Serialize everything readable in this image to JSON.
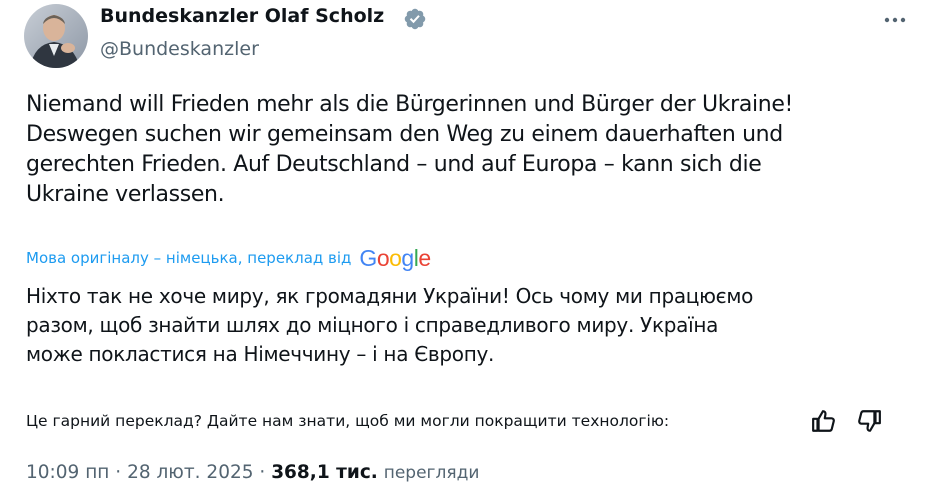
{
  "author": {
    "name": "Bundeskanzler Olaf Scholz",
    "handle": "@Bundeskanzler",
    "verified_color": "#829aab"
  },
  "tweet": {
    "original_lines": [
      "Niemand will Frieden mehr als die Bürgerinnen und Bürger der Ukraine!",
      "Deswegen suchen wir gemeinsam den Weg zu einem dauerhaften und",
      "gerechten Frieden. Auf Deutschland – und auf Europa – kann sich die",
      "Ukraine verlassen."
    ],
    "translation_notice": "Мова оригіналу – німецька, переклад від",
    "translation_provider": [
      "G",
      "o",
      "o",
      "g",
      "l",
      "e"
    ],
    "translated_lines": [
      "Ніхто так не хоче миру, як громадяни України! Ось чому ми працюємо",
      "разом, щоб знайти шлях до міцного і справедливого миру. Україна",
      "може покластися на Німеччину – і на Європу."
    ],
    "feedback_prompt": "Це гарний переклад? Дайте нам знати, щоб ми могли покращити технологію:"
  },
  "meta": {
    "time": "10:09 пп",
    "separator": "·",
    "date": "28 лют. 2025",
    "views_count": "368,1 тис.",
    "views_label": "перегляди"
  },
  "colors": {
    "link": "#1d9bf0",
    "secondary_text": "#536471",
    "primary_text": "#0f1419",
    "google": [
      "#4285f4",
      "#ea4335",
      "#fbbc05",
      "#4285f4",
      "#34a853",
      "#ea4335"
    ]
  },
  "icons": {
    "more": "more-horizontal-icon",
    "verified": "verified-badge-icon",
    "thumb_up": "thumbs-up-icon",
    "thumb_down": "thumbs-down-icon"
  }
}
